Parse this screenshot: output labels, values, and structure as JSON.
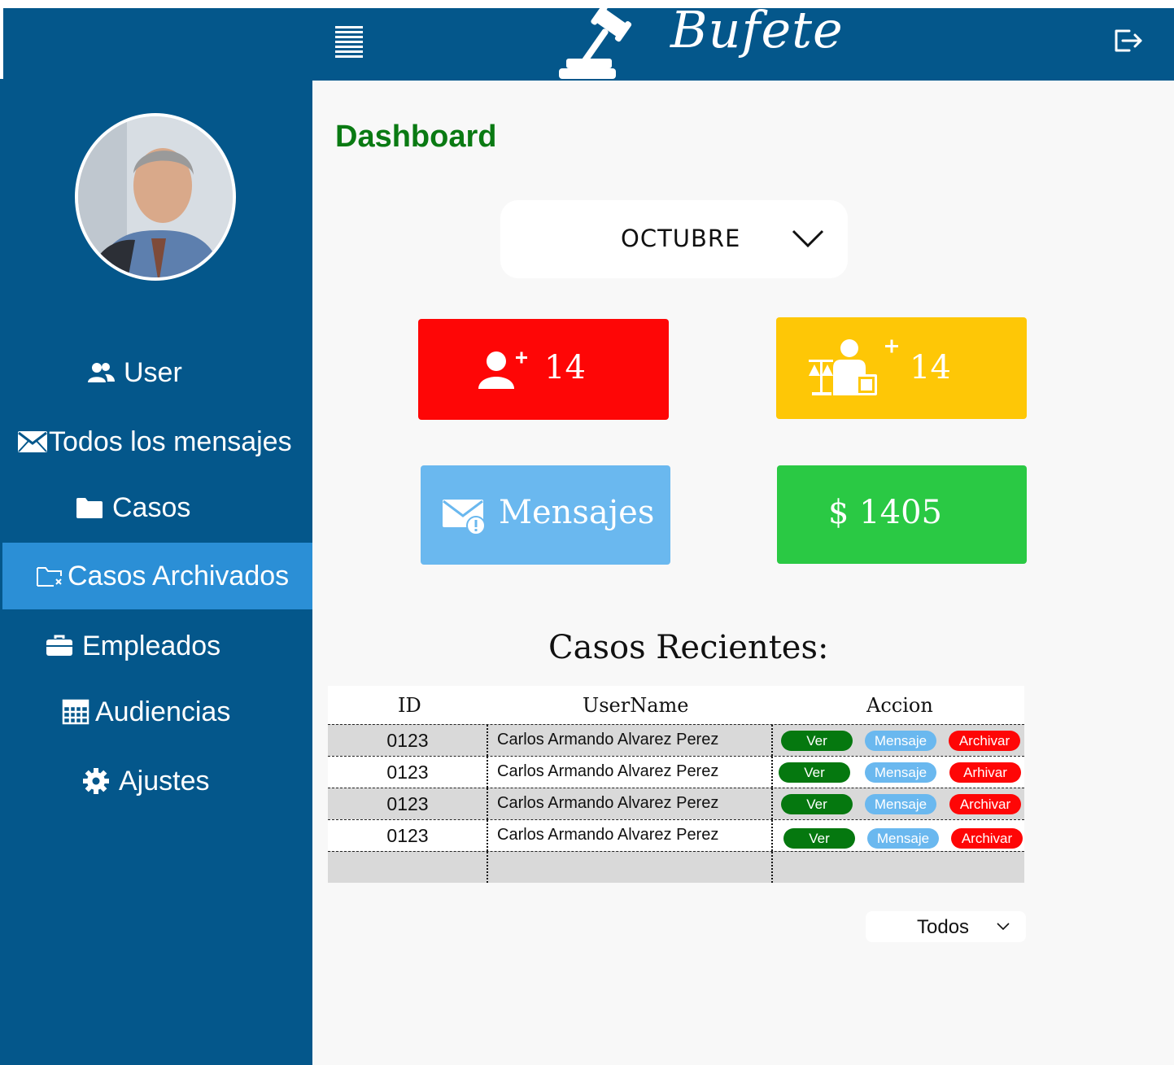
{
  "header": {
    "brand": "Bufete"
  },
  "sidebar": {
    "items": [
      {
        "label": "User",
        "icon": "users-icon"
      },
      {
        "label": "Todos los mensajes",
        "icon": "envelope-icon"
      },
      {
        "label": "Casos",
        "icon": "folder-icon"
      },
      {
        "label": "Casos Archivados",
        "icon": "folder-archive-icon",
        "active": true
      },
      {
        "label": "Empleados",
        "icon": "briefcase-icon"
      },
      {
        "label": "Audiencias",
        "icon": "calendar-grid-icon"
      },
      {
        "label": "Ajustes",
        "icon": "gear-icon"
      }
    ]
  },
  "main": {
    "title": "Dashboard",
    "month": "OCTUBRE",
    "cards": {
      "new_users": "14",
      "new_lawyers": "14",
      "messages": "Mensajes",
      "revenue": "$ 1405"
    },
    "recent_title": "Casos Recientes:",
    "table": {
      "headers": {
        "id": "ID",
        "username": "UserName",
        "accion": "Accion"
      },
      "rows": [
        {
          "id": "0123",
          "name": "Carlos Armando Alvarez Perez",
          "ver": "Ver",
          "mensaje": "Mensaje",
          "archivar": "Archivar"
        },
        {
          "id": "0123",
          "name": "Carlos Armando Alvarez Perez",
          "ver": "Ver",
          "mensaje": "Mensaje",
          "archivar": "Arhivar"
        },
        {
          "id": "0123",
          "name": "Carlos Armando Alvarez Perez",
          "ver": "Ver",
          "mensaje": "Mensaje",
          "archivar": "Archivar"
        },
        {
          "id": "0123",
          "name": "Carlos Armando Alvarez Perez",
          "ver": "Ver",
          "mensaje": "Mensaje",
          "archivar": "Archivar"
        }
      ]
    },
    "filter": "Todos"
  },
  "colors": {
    "primary": "#04578b",
    "active": "#2b8fd6",
    "title_green": "#0a7a13",
    "red": "#fe0606",
    "yellow": "#fec706",
    "light_blue": "#6ab8ef",
    "green": "#2ac944",
    "dark_green": "#05780f"
  }
}
